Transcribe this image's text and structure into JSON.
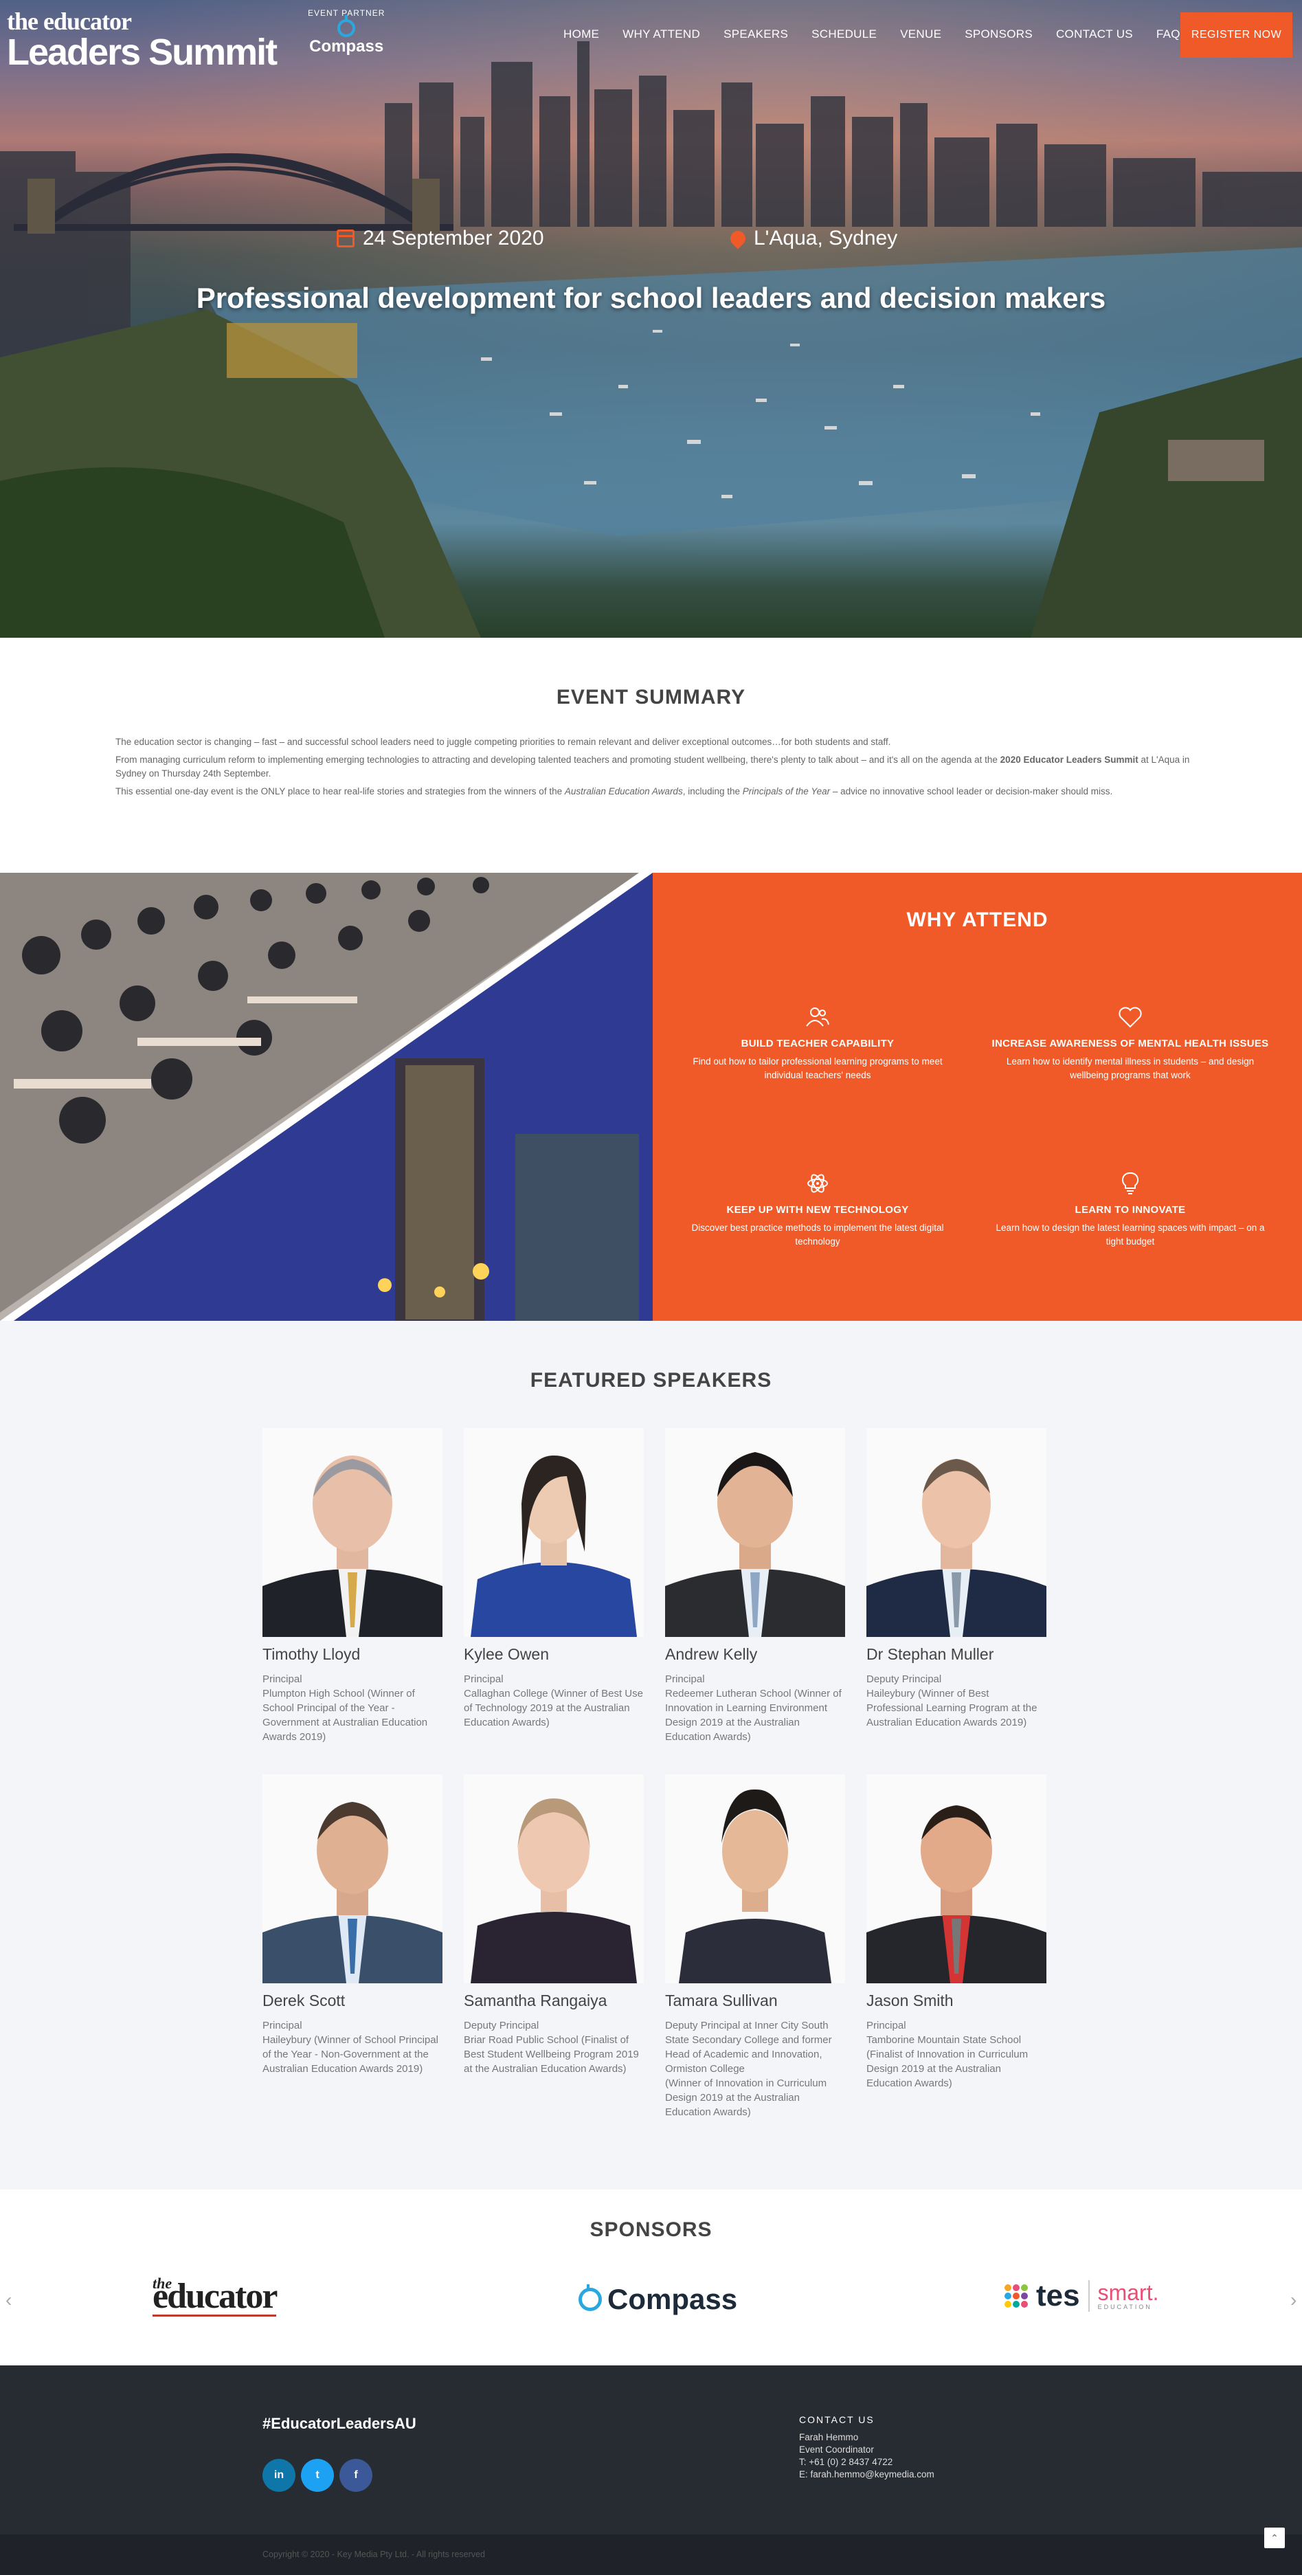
{
  "brand": {
    "logo_small": "the educator",
    "logo_big": "Leaders Summit",
    "partner_label": "EVENT PARTNER",
    "partner_name": "Compass"
  },
  "nav": [
    "HOME",
    "WHY ATTEND",
    "SPEAKERS",
    "SCHEDULE",
    "VENUE",
    "SPONSORS",
    "CONTACT US",
    "FAQS"
  ],
  "register_label": "REGISTER NOW",
  "hero": {
    "date": "24 September 2020",
    "venue": "L'Aqua, Sydney",
    "headline": "Professional development for school leaders and decision makers"
  },
  "summary": {
    "title": "EVENT SUMMARY",
    "p1": "The education sector is changing – fast – and successful school leaders need to juggle competing priorities to remain relevant and deliver exceptional outcomes…for both students and staff.",
    "p2_a": "From managing curriculum reform to implementing emerging technologies to attracting and developing talented teachers and promoting student wellbeing, there's plenty to talk about – and it's all on the agenda at the ",
    "p2_b": "2020 Educator Leaders Summit",
    "p2_c": " at L'Aqua in Sydney on Thursday 24th September.",
    "p3_a": "This essential one-day event is the ONLY place to hear real-life stories and strategies from the winners of the ",
    "p3_b": "Australian Education Awards",
    "p3_c": ", including the ",
    "p3_d": "Principals of the Year",
    "p3_e": " – advice no innovative school leader or decision-maker should miss."
  },
  "why": {
    "title": "WHY ATTEND",
    "features": [
      {
        "icon": "people-icon",
        "title": "BUILD TEACHER CAPABILITY",
        "desc": "Find out how to tailor professional learning programs to meet individual teachers' needs"
      },
      {
        "icon": "heart-icon",
        "title": "INCREASE AWARENESS OF MENTAL HEALTH ISSUES",
        "desc": "Learn how to identify mental illness in students – and design wellbeing programs that work"
      },
      {
        "icon": "atom-icon",
        "title": "KEEP UP WITH NEW TECHNOLOGY",
        "desc": "Discover best practice methods to implement the latest digital technology"
      },
      {
        "icon": "lightbulb-icon",
        "title": "LEARN TO INNOVATE",
        "desc": "Learn how to design the latest learning spaces with impact – on a tight budget"
      }
    ]
  },
  "speakers": {
    "title": "FEATURED SPEAKERS",
    "list": [
      {
        "name": "Timothy Lloyd",
        "role": "Principal",
        "org": "Plumpton High School (Winner of School Principal of the Year - Government at Australian Education Awards 2019)"
      },
      {
        "name": "Kylee Owen",
        "role": "Principal",
        "org": "Callaghan College (Winner of Best Use of Technology 2019 at the Australian Education Awards)"
      },
      {
        "name": "Andrew Kelly",
        "role": "Principal",
        "org": "Redeemer Lutheran School (Winner of Innovation in Learning Environment Design 2019 at the Australian Education Awards)"
      },
      {
        "name": "Dr Stephan Muller",
        "role": "Deputy Principal",
        "org": "Haileybury (Winner of Best Professional Learning Program at the Australian Education Awards 2019)"
      },
      {
        "name": "Derek Scott",
        "role": "Principal",
        "org": "Haileybury (Winner of School Principal of the Year - Non-Government at the Australian Education Awards 2019)"
      },
      {
        "name": "Samantha Rangaiya",
        "role": "Deputy Principal",
        "org": "Briar Road Public School (Finalist of Best Student Wellbeing Program 2019 at the Australian Education Awards)"
      },
      {
        "name": "Tamara Sullivan",
        "role": "Deputy Principal at Inner City South State Secondary College and former Head of Academic and Innovation, Ormiston College",
        "org": "(Winner of Innovation in Curriculum Design 2019 at the Australian Education Awards)"
      },
      {
        "name": "Jason Smith",
        "role": "Principal",
        "org": "Tamborine Mountain State School (Finalist of Innovation in Curriculum Design 2019 at the Australian Education Awards)"
      }
    ]
  },
  "sponsors": {
    "title": "SPONSORS",
    "educator_small": "the",
    "educator_big": "educator",
    "compass": "Compass",
    "tes": "tes",
    "smart": "smart.",
    "smart_sub": "EDUCATION"
  },
  "footer": {
    "hashtag": "#EducatorLeadersAU",
    "social": [
      "in",
      "t",
      "f"
    ],
    "contact_heading": "CONTACT US",
    "contact_name": "Farah Hemmo",
    "contact_title": "Event Coordinator",
    "contact_phone": "T: +61 (0) 2 8437 4722",
    "contact_email": "E: farah.hemmo@keymedia.com",
    "copyright": "Copyright © 2020 - Key Media Pty Ltd. - All rights reserved"
  },
  "colors": {
    "accent": "#f05a28",
    "footer": "#272b32",
    "light_bg": "#f4f5f9"
  }
}
